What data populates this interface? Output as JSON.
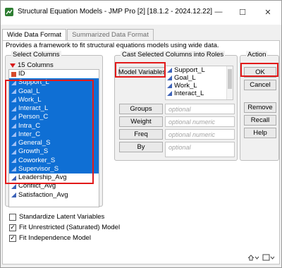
{
  "window": {
    "title": "Structural Equation Models - JMP Pro [2] [18.1.2 - 2024.12.22]",
    "controls": {
      "minimize": "—",
      "maximize": "☐",
      "close": "✕"
    }
  },
  "tabs": [
    {
      "label": "Wide Data Format",
      "active": true
    },
    {
      "label": "Summarized Data Format",
      "active": false
    }
  ],
  "description": "Provides a framework to fit structural equations models using wide data.",
  "select_columns": {
    "title": "Select Columns",
    "count": "15 Columns",
    "items": [
      {
        "label": "ID",
        "icon": "id-icon",
        "selected": false
      },
      {
        "label": "Support_L",
        "icon": "continuous-icon",
        "selected": true
      },
      {
        "label": "Goal_L",
        "icon": "continuous-icon",
        "selected": true
      },
      {
        "label": "Work_L",
        "icon": "continuous-icon",
        "selected": true
      },
      {
        "label": "Interact_L",
        "icon": "continuous-icon",
        "selected": true
      },
      {
        "label": "Person_C",
        "icon": "continuous-icon",
        "selected": true
      },
      {
        "label": "Intra_C",
        "icon": "continuous-icon",
        "selected": true
      },
      {
        "label": "Inter_C",
        "icon": "continuous-icon",
        "selected": true
      },
      {
        "label": "General_S",
        "icon": "continuous-icon",
        "selected": true
      },
      {
        "label": "Growth_S",
        "icon": "continuous-icon",
        "selected": true
      },
      {
        "label": "Coworker_S",
        "icon": "continuous-icon",
        "selected": true
      },
      {
        "label": "Supervisor_S",
        "icon": "continuous-icon",
        "selected": true
      },
      {
        "label": "Leadership_Avg",
        "icon": "continuous-icon",
        "selected": false
      },
      {
        "label": "Conflict_Avg",
        "icon": "continuous-icon",
        "selected": false
      },
      {
        "label": "Satisfaction_Avg",
        "icon": "continuous-icon",
        "selected": false
      }
    ]
  },
  "cast_roles": {
    "title": "Cast Selected Columns into Roles",
    "model_variables_label": "Model Variables",
    "model_variables": [
      "Support_L",
      "Goal_L",
      "Work_L",
      "Interact_L"
    ],
    "roles": [
      {
        "button": "Groups",
        "placeholder": "optional"
      },
      {
        "button": "Weight",
        "placeholder": "optional numeric"
      },
      {
        "button": "Freq",
        "placeholder": "optional numeric"
      },
      {
        "button": "By",
        "placeholder": "optional"
      }
    ]
  },
  "action": {
    "title": "Action",
    "ok": "OK",
    "cancel": "Cancel",
    "remove": "Remove",
    "recall": "Recall",
    "help": "Help"
  },
  "options": [
    {
      "label": "Standardize Latent Variables",
      "checked": false
    },
    {
      "label": "Fit Unrestricted (Saturated) Model",
      "checked": true
    },
    {
      "label": "Fit Independence Model",
      "checked": true
    }
  ],
  "checkmark": "✓",
  "colors": {
    "selection": "#0f6fd4",
    "highlight_box": "#e21a1a",
    "column_icon": "#3d63b8"
  }
}
